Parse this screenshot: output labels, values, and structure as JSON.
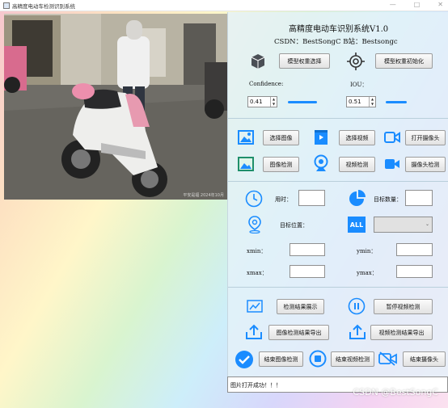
{
  "window": {
    "title": "高精度电动车检测识别系统",
    "minimize": "—",
    "maximize": "□",
    "close": "✕"
  },
  "header": {
    "title": "高精度电动车识别系统V1.0",
    "author": "CSDN：BestSongC   B站：Bestsongc"
  },
  "weights": {
    "select_label": "模型权重选择",
    "init_label": "模型权重初始化"
  },
  "params": {
    "confidence_label": "Confidence:",
    "confidence_value": "0.41",
    "confidence_level": 0.41,
    "iou_label": "IOU：",
    "iou_value": "0.51",
    "iou_level": 0.51
  },
  "sources": {
    "select_image": "选择图像",
    "select_video": "选择视频",
    "open_camera": "打开摄像头",
    "image_detect": "图像检测",
    "video_detect": "视频检测",
    "camera_detect": "摄像头检测"
  },
  "results": {
    "time_label": "用时：",
    "time_value": "",
    "count_label": "目标数量：",
    "count_value": "",
    "position_label": "目标位置：",
    "target_select_value": "",
    "xmin_label": "xmin：",
    "ymin_label": "ymin：",
    "xmax_label": "xmax：",
    "ymax_label": "ymax："
  },
  "actions": {
    "show_results": "检测结果展示",
    "pause_video": "暂停视频检测",
    "export_image": "图像检测结果导出",
    "export_video": "视频检测结果导出",
    "end_image": "结束图像检测",
    "end_video": "结束视频检测",
    "end_camera": "结束摄像头"
  },
  "status": {
    "message": "图片打开成功！！！"
  },
  "photo": {
    "caption": "平安是福 2024年10月"
  },
  "watermark": "CSDN @BestSongC",
  "colors": {
    "accent": "#1a8cff",
    "panel": "#e4f2f9"
  },
  "icons": [
    "cube-icon",
    "target-icon",
    "image-icon",
    "video-file-icon",
    "camera-icon",
    "image-detect-icon",
    "webcam-icon",
    "video-camera-icon",
    "clock-icon",
    "pie-chart-icon",
    "location-pin-icon",
    "all-icon",
    "chart-icon",
    "pause-icon",
    "upload-icon",
    "check-icon",
    "stop-icon",
    "camera-off-icon"
  ]
}
